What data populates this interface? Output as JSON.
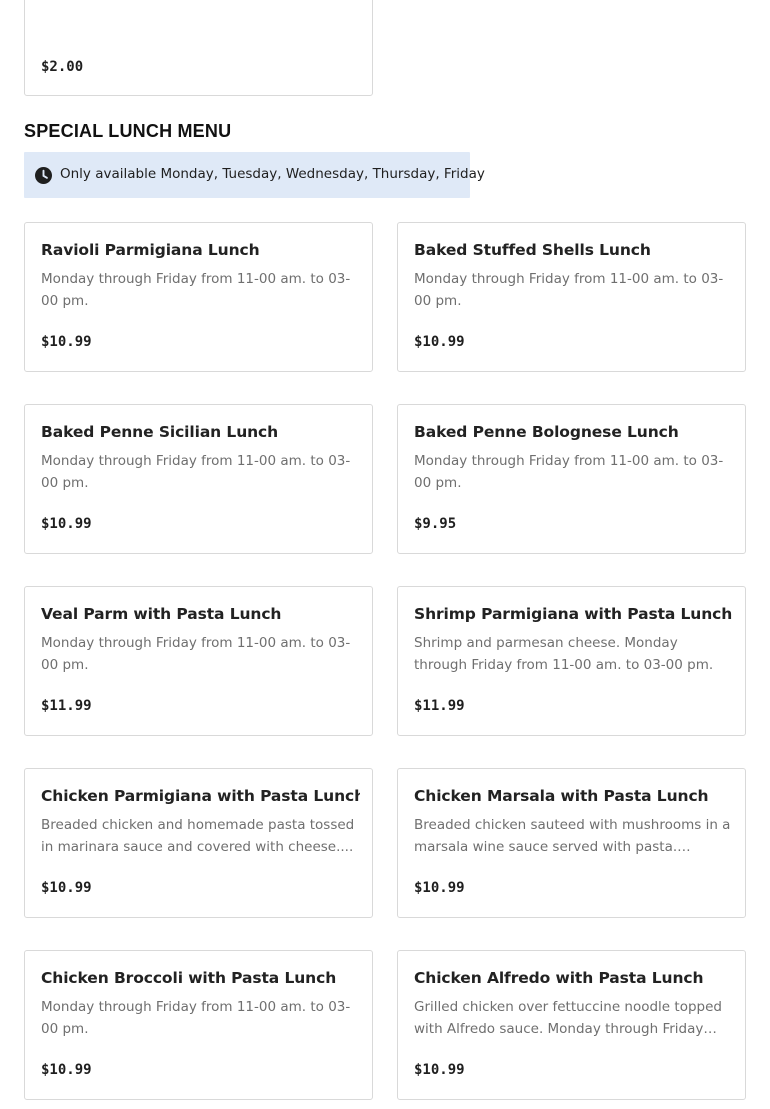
{
  "previous_item": {
    "price": "$2.00"
  },
  "section": {
    "title": "SPECIAL LUNCH MENU",
    "availability": "Only available Monday, Tuesday, Wednesday, Thursday, Friday"
  },
  "items": [
    {
      "name": "Ravioli Parmigiana Lunch",
      "description": "Monday through Friday from 11-00 am. to 03-00 pm.",
      "price": "$10.99"
    },
    {
      "name": "Baked Stuffed Shells Lunch",
      "description": "Monday through Friday from 11-00 am. to 03-00 pm.",
      "price": "$10.99"
    },
    {
      "name": "Baked Penne Sicilian Lunch",
      "description": "Monday through Friday from 11-00 am. to 03-00 pm.",
      "price": "$10.99"
    },
    {
      "name": "Baked Penne Bolognese Lunch",
      "description": "Monday through Friday from 11-00 am. to 03-00 pm.",
      "price": "$9.95"
    },
    {
      "name": "Veal Parm with Pasta Lunch",
      "description": "Monday through Friday from 11-00 am. to 03-00 pm.",
      "price": "$11.99"
    },
    {
      "name": "Shrimp Parmigiana with Pasta Lunch",
      "description": "Shrimp and parmesan cheese. Monday through Friday from 11-00 am. to 03-00 pm.",
      "price": "$11.99"
    },
    {
      "name": "Chicken Parmigiana with Pasta Lunch",
      "description": "Breaded chicken and homemade pasta tossed in marinara sauce and covered with cheese....",
      "price": "$10.99"
    },
    {
      "name": "Chicken Marsala with Pasta Lunch",
      "description": "Breaded chicken sauteed with mushrooms in a marsala wine sauce served with pasta. Monday...",
      "price": "$10.99"
    },
    {
      "name": "Chicken Broccoli with Pasta Lunch",
      "description": "Monday through Friday from 11-00 am. to 03-00 pm.",
      "price": "$10.99"
    },
    {
      "name": "Chicken Alfredo with Pasta Lunch",
      "description": "Grilled chicken over fettuccine noodle topped with Alfredo sauce. Monday through Friday fro...",
      "price": "$10.99"
    }
  ]
}
